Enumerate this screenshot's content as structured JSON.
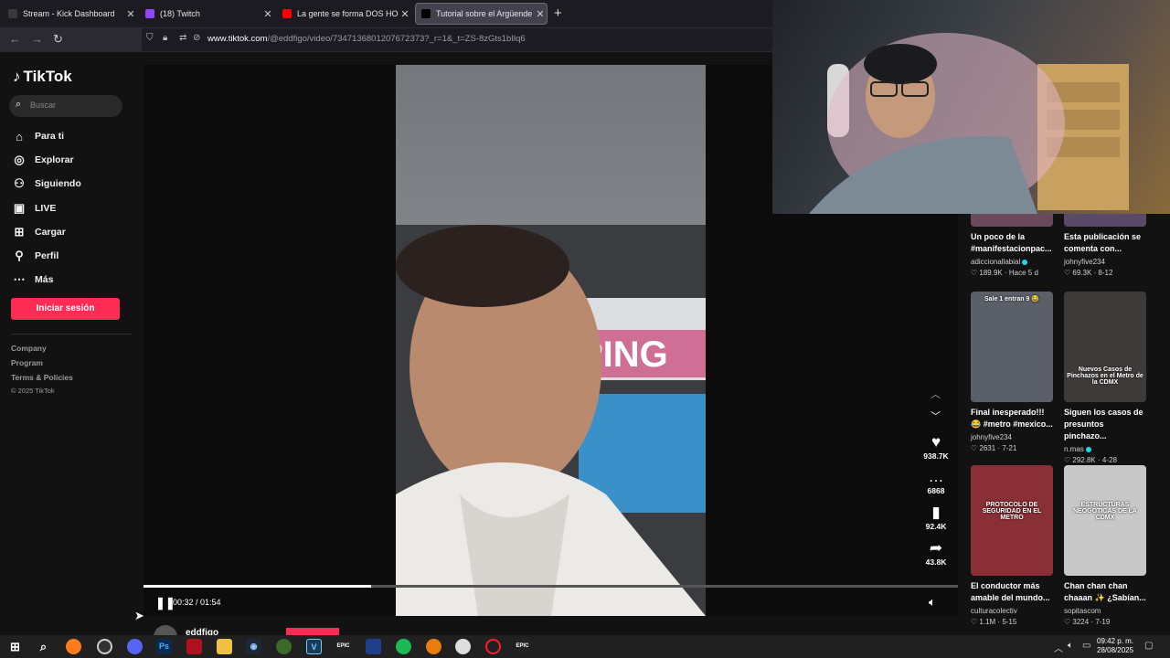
{
  "browser": {
    "tabs": [
      {
        "label": "Stream - Kick Dashboard",
        "close": "✕",
        "icon": "kick-icon",
        "color": "#3a3a3a"
      },
      {
        "label": "(18) Twitch",
        "close": "✕",
        "icon": "twitch-icon",
        "color": "#9146ff"
      },
      {
        "label": "La gente se forma DOS HORAS",
        "close": "✕",
        "icon": "youtube-icon",
        "color": "#ff0000"
      },
      {
        "label": "Tutorial sobre el Argüende",
        "close": "✕",
        "icon": "tiktok-icon",
        "color": "#000000"
      }
    ],
    "new_tab": "+",
    "url_host": "www.tiktok.com",
    "url_path": "/@eddfigo/video/7347136801207672373?_r=1&_t=ZS-8zGts1bIlq6"
  },
  "sidebar": {
    "logo": "TikTok",
    "search_placeholder": "Buscar",
    "items": [
      {
        "label": "Para ti",
        "icon": "home-icon"
      },
      {
        "label": "Explorar",
        "icon": "compass-icon"
      },
      {
        "label": "Siguiendo",
        "icon": "following-icon"
      },
      {
        "label": "LIVE",
        "icon": "live-icon"
      },
      {
        "label": "Cargar",
        "icon": "upload-icon"
      },
      {
        "label": "Perfil",
        "icon": "profile-icon"
      },
      {
        "label": "Más",
        "icon": "more-icon"
      }
    ],
    "login": "Iniciar sesión",
    "footer": [
      "Company",
      "Program",
      "Terms & Policies"
    ],
    "copyright": "© 2025 TikTok"
  },
  "player": {
    "time": "00:32 / 01:54",
    "progress": 0.28,
    "author": "eddfigo",
    "sign_text": "PING"
  },
  "actions": [
    {
      "name": "like",
      "icon": "heart-icon",
      "glyph": "♥",
      "value": "938.7K"
    },
    {
      "name": "comment",
      "icon": "comment-icon",
      "glyph": "…",
      "value": "6868"
    },
    {
      "name": "save",
      "icon": "bookmark-icon",
      "glyph": "▮",
      "value": "92.4K"
    },
    {
      "name": "share",
      "icon": "share-icon",
      "glyph": "➦",
      "value": "43.8K"
    }
  ],
  "related": [
    {
      "title": "Un poco de la #manifestacionpac...",
      "author": "adiccionallabial",
      "verified": true,
      "likes": "189.9K",
      "date": "Hace 5 d",
      "overlay": "",
      "bg": "#6a4a5a"
    },
    {
      "title": "Esta publicación se comenta con...",
      "author": "johnyfive234",
      "verified": false,
      "likes": "69.3K",
      "date": "8-12",
      "overlay": "",
      "bg": "#5a4a6a"
    },
    {
      "title": "Final inesperado!!! 😂 #metro #mexico...",
      "author": "johnyfive234",
      "verified": false,
      "likes": "2631",
      "date": "7-21",
      "overlay": "Sale 1 entran 9 😂",
      "bg": "#5a5f68"
    },
    {
      "title": "Siguen los casos de presuntos pinchazo...",
      "author": "n.mas",
      "verified": true,
      "likes": "292.8K",
      "date": "4-28",
      "overlay": "Nuevos Casos de Pinchazos en el Metro de la CDMX",
      "bg": "#3e3a3a"
    },
    {
      "title": "El conductor más amable del mundo...",
      "author": "culturacolectiv",
      "verified": false,
      "likes": "1.1M",
      "date": "5-15",
      "overlay": "PROTOCOLO DE SEGURIDAD EN EL METRO",
      "bg": "#8a2f35"
    },
    {
      "title": "Chan chan chan chaaan ✨ ¿Sabían...",
      "author": "sopitascom",
      "verified": false,
      "likes": "3224",
      "date": "7-19",
      "overlay": "ESTRUCTURAS NEOGÓTICAS DE LA CDMX",
      "bg": "#c8c8c8"
    }
  ],
  "taskbar": {
    "time": "09:42 p. m.",
    "date": "28/08/2025"
  }
}
